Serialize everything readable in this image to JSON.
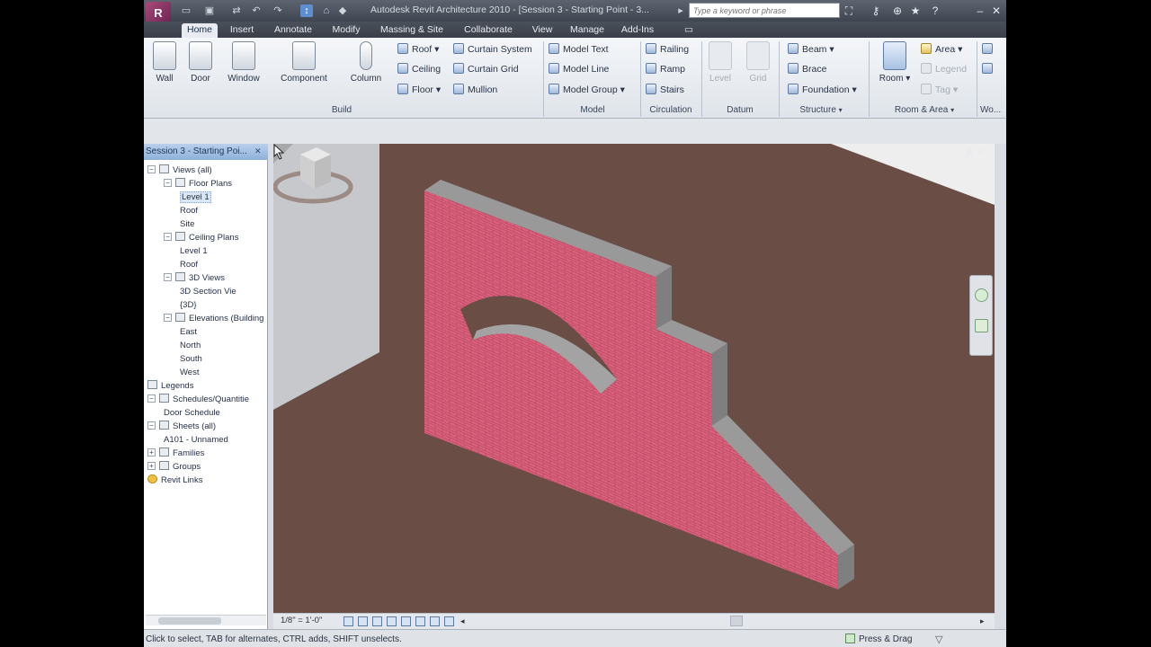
{
  "window": {
    "logo_letter": "R",
    "title": "Autodesk Revit Architecture 2010 - [Session 3 - Starting Point - 3...",
    "search_placeholder": "Type a keyword or phrase",
    "icons": [
      "binoculars-icon",
      "key-icon",
      "star-icon",
      "help-icon",
      "close-icon"
    ]
  },
  "tabs": [
    "Home",
    "Insert",
    "Annotate",
    "Modify",
    "Massing & Site",
    "Collaborate",
    "View",
    "Manage",
    "Add-Ins"
  ],
  "active_tab": "Home",
  "ribbon": {
    "build": {
      "big": [
        "Wall",
        "Door",
        "Window",
        "Component",
        "Column"
      ],
      "col1": [
        "Roof",
        "Ceiling",
        "Floor"
      ],
      "col2": [
        "Curtain System",
        "Curtain Grid",
        "Mullion"
      ],
      "label": "Build"
    },
    "model": {
      "items": [
        "Model Text",
        "Model Line",
        "Model Group"
      ],
      "label": "Model"
    },
    "circulation": {
      "items": [
        "Railing",
        "Ramp",
        "Stairs"
      ],
      "label": "Circulation"
    },
    "datum": {
      "items": [
        "Level",
        "Grid"
      ],
      "label": "Datum"
    },
    "structure": {
      "items": [
        "Beam",
        "Brace",
        "Foundation"
      ],
      "label": "Structure"
    },
    "room_area": {
      "room": "Room",
      "items": [
        "Area",
        "Legend",
        "Tag"
      ],
      "label": "Room & Area"
    },
    "overflow_label": "Wo..."
  },
  "browser": {
    "title": "Session 3 - Starting Poi...",
    "items": [
      {
        "label": "Views (all)",
        "level": 0
      },
      {
        "label": "Floor Plans",
        "level": 1
      },
      {
        "label": "Level 1",
        "level": 2,
        "selected": true
      },
      {
        "label": "Roof",
        "level": 2
      },
      {
        "label": "Site",
        "level": 2
      },
      {
        "label": "Ceiling Plans",
        "level": 1
      },
      {
        "label": "Level 1",
        "level": 2
      },
      {
        "label": "Roof",
        "level": 2
      },
      {
        "label": "3D Views",
        "level": 1
      },
      {
        "label": "3D Section Vie",
        "level": 2
      },
      {
        "label": "{3D}",
        "level": 2
      },
      {
        "label": "Elevations (Building",
        "level": 1
      },
      {
        "label": "East",
        "level": 2
      },
      {
        "label": "North",
        "level": 2
      },
      {
        "label": "South",
        "level": 2
      },
      {
        "label": "West",
        "level": 2
      },
      {
        "label": "Legends",
        "level": 0
      },
      {
        "label": "Schedules/Quantitie",
        "level": 0
      },
      {
        "label": "Door Schedule",
        "level": 1
      },
      {
        "label": "Sheets (all)",
        "level": 0
      },
      {
        "label": "A101 - Unnamed",
        "level": 1
      },
      {
        "label": "Families",
        "level": 0
      },
      {
        "label": "Groups",
        "level": 0
      },
      {
        "label": "Revit Links",
        "level": 0
      }
    ]
  },
  "viewbar": {
    "scale": "1/8\" = 1'-0\""
  },
  "status": {
    "hint": "Click to select, TAB for alternates, CTRL adds, SHIFT unselects.",
    "press_drag": "Press & Drag"
  },
  "colors": {
    "viewport_bg": "#6a4d45",
    "wall_face": "#d9627d",
    "wall_edge": "#8c8c8c",
    "accent": "#2b5797"
  }
}
